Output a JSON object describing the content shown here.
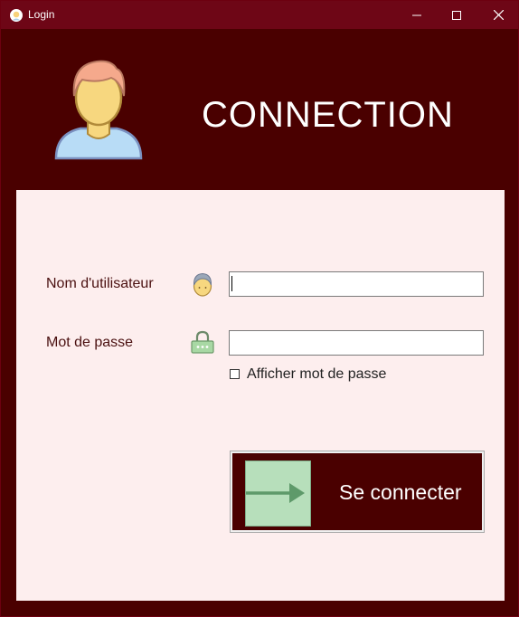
{
  "window": {
    "title": "Login",
    "controls": {
      "minimize": "minimize",
      "maximize": "maximize",
      "close": "close"
    }
  },
  "header": {
    "title": "CONNECTION",
    "avatar_icon": "user-avatar-icon"
  },
  "form": {
    "username": {
      "label": "Nom d'utilisateur",
      "value": "",
      "icon": "user-icon"
    },
    "password": {
      "label": "Mot de passe",
      "value": "",
      "icon": "lock-icon"
    },
    "show_password": {
      "label": "Afficher mot de passe",
      "checked": false
    },
    "submit": {
      "label": "Se connecter",
      "icon": "arrow-right-icon"
    }
  },
  "colors": {
    "titlebar": "#6e0616",
    "background": "#4a0000",
    "panel": "#fdeeee",
    "button_bg": "#4a0000",
    "arrow_box": "#b7dfbb"
  }
}
